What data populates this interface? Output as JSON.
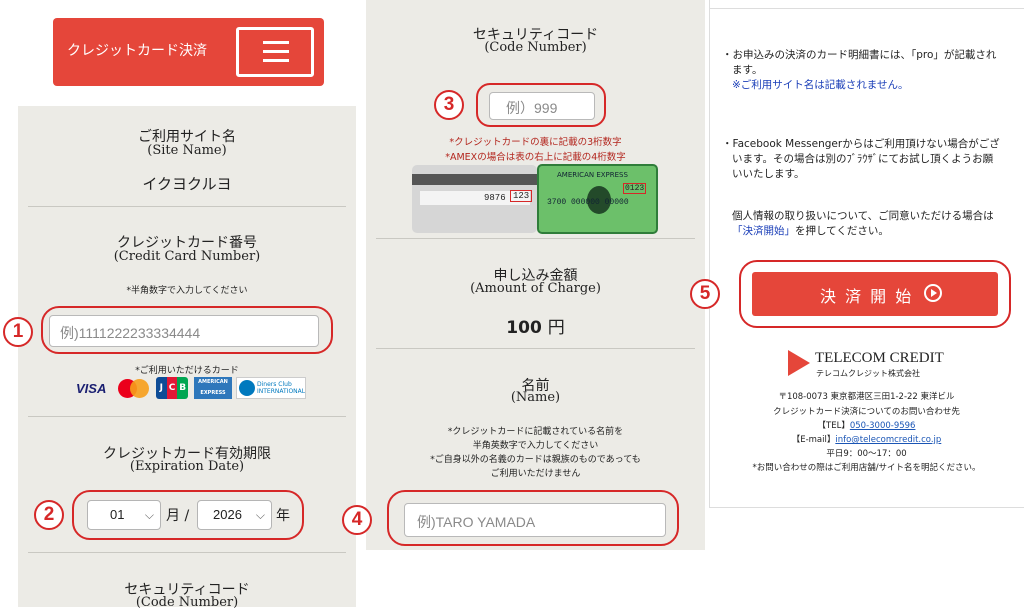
{
  "header": {
    "title": "クレジットカード決済"
  },
  "site": {
    "label_jp": "ご利用サイト名",
    "label_en": "(Site Name)",
    "value": "イクヨクルヨ"
  },
  "card_number": {
    "label_jp": "クレジットカード番号",
    "label_en": "(Credit Card Number)",
    "hint": "*半角数字で入力してください",
    "placeholder": "例)1111222233334444",
    "accepted_label": "*ご利用いただけるカード",
    "brands": [
      "VISA",
      "Mastercard",
      "JCB",
      "AMERICAN EXPRESS",
      "Diners Club INTERNATIONAL"
    ]
  },
  "expiry": {
    "label_jp": "クレジットカード有効期限",
    "label_en": "(Expiration Date)",
    "month": "01",
    "month_unit": "月 /",
    "year": "2026",
    "year_unit": "年"
  },
  "security": {
    "label_jp": "セキュリティコード",
    "label_en": "(Code Number)",
    "placeholder": "例）999",
    "note1": "*クレジットカードの裏に記載の3桁数字",
    "note2": "*AMEXの場合は表の右上に記載の4桁数字",
    "card_back_num": "9876",
    "card_back_code": "123",
    "amex_name": "AMERICAN EXPRESS",
    "amex_code": "0123",
    "amex_number": "3700 000000 00000"
  },
  "amount": {
    "label_jp": "申し込み金額",
    "label_en": "(Amount of Charge)",
    "value": "100",
    "unit": "円"
  },
  "name": {
    "label_jp": "名前",
    "label_en": "(Name)",
    "note1": "*クレジットカードに記載されている名前を",
    "note2": "半角英数字で入力してください",
    "note3": "*ご自身以外の名義のカードは親族のものであっても",
    "note4": "ご利用いただけません",
    "placeholder": "例)TARO YAMADA"
  },
  "right": {
    "p1a": "・お申込みの決済のカード明細書には、「pro」が記載され",
    "p1b": "ます。",
    "p1c": "※ご利用サイト名は記載されません。",
    "p2a": "・Facebook Messengerからはご利用頂けない場合がござ",
    "p2b": "います。その場合は別のﾌﾞﾗｳｻﾞにてお試し頂くようお願",
    "p2c": "いいたします。",
    "p3a": "個人情報の取り扱いについて、ご同意いただける場合は",
    "p3b_link": "「決済開始」",
    "p3b_rest": "を押してください。",
    "pay_button": "決 済 開 始",
    "company_logo": "TELECOM CREDIT",
    "company_sub": "テレコムクレジット株式会社",
    "address": "〒108-0073 東京都港区三田1-2-22 東洋ビル",
    "inquiry": "クレジットカード決済についてのお問い合わせ先",
    "tel_label": "【TEL】",
    "tel": "050-3000-9596",
    "email_label": "【E-mail】",
    "email": "info@telecomcredit.co.jp",
    "hours": "平日9：00〜17：00",
    "footer_note": "*お問い合わせの際はご利用店舗/サイト名を明記ください。"
  },
  "markers": [
    "1",
    "2",
    "3",
    "4",
    "5"
  ],
  "colors": {
    "brand_red": "#e5463a",
    "annotation_red": "#d62828",
    "panel": "#ecebe6"
  }
}
